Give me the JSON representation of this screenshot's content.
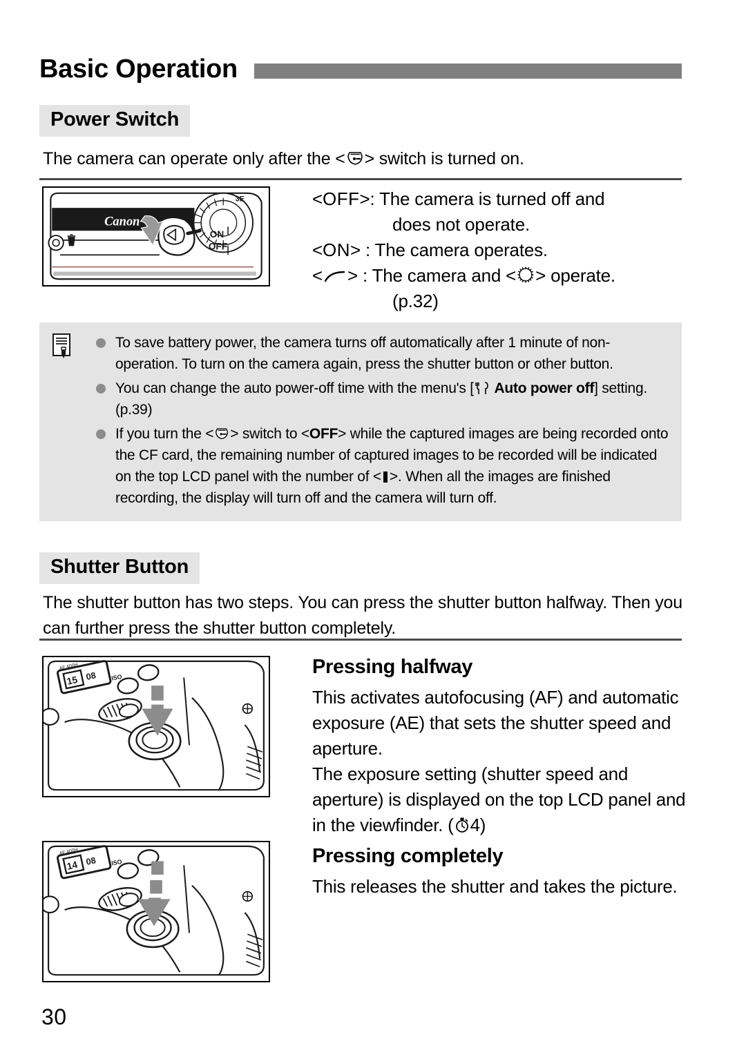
{
  "document": {
    "chapter_title": "Basic Operation",
    "page_number": "30",
    "accent_bar_color": "#808080",
    "chip_background": "#e4e4e4",
    "note_background": "#e4e4e4",
    "bullet_color": "#8c8c8c"
  },
  "power_switch": {
    "heading": "Power Switch",
    "intro_before": "The camera can operate only after the <",
    "intro_icon": "power-switch-icon",
    "intro_after": "> switch is turned on.",
    "figure_name": "power-switch-illustration",
    "figure_labels": {
      "brand": "Canon",
      "on": "ON",
      "off": "OFF",
      "erase": "trash-icon"
    },
    "modes": [
      {
        "key_prefix": "<",
        "key": "OFF",
        "key_suffix": ">:",
        "line1": "The camera is turned off and",
        "line2": "does not operate."
      },
      {
        "key_prefix": "<",
        "key": "ON",
        "key_suffix": "> :",
        "line1": "The camera operates.",
        "line2": ""
      },
      {
        "key_prefix": "<",
        "key": "power-on-dial-icon",
        "key_suffix": "> :",
        "line1_before": "The camera and <",
        "line1_icon": "quick-control-dial-icon",
        "line1_after": "> operate.",
        "line2": "(p.32)"
      }
    ]
  },
  "note_box": {
    "icon": "note-pencil-icon",
    "items": [
      {
        "text": "To save battery power, the camera turns off automatically after 1 minute of non-operation. To turn on the camera again, press the shutter button or other button."
      },
      {
        "part1": "You can change the auto power-off time with the menu's [",
        "icon": "setup-menu-icon",
        "bold_text": "Auto power off",
        "part2": "] setting. (p.39)"
      },
      {
        "part1": "If you turn the <",
        "icon1": "power-switch-icon",
        "part2": "> switch to <",
        "strong1": "OFF",
        "part3": "> while the captured images are being recorded onto the CF card, the remaining number of captured images to be recorded will be indicated on the top LCD panel with the number of <",
        "icon2": "buffer-bar-icon",
        "part4": ">.  When all the images are finished recording, the display will turn off and the camera will turn off."
      }
    ]
  },
  "shutter_button": {
    "heading": "Shutter Button",
    "intro": "The shutter button has two steps. You can press the shutter button halfway. Then you can further press the shutter button completely.",
    "subsections": [
      {
        "heading": "Pressing halfway",
        "figure_name": "shutter-halfway-illustration",
        "paragraph1": "This activates autofocusing (AF) and automatic exposure (AE) that sets the shutter speed and aperture.",
        "paragraph2_before": "The exposure setting (shutter speed and aperture) is displayed on the top LCD panel and in the viewfinder. (",
        "paragraph2_icon": "metering-timer-icon",
        "paragraph2_after": "4)"
      },
      {
        "heading": "Pressing completely",
        "figure_name": "shutter-fully-illustration",
        "paragraph1": "This releases the shutter and takes the picture.",
        "paragraph2_before": "",
        "paragraph2_icon": "",
        "paragraph2_after": ""
      }
    ]
  }
}
